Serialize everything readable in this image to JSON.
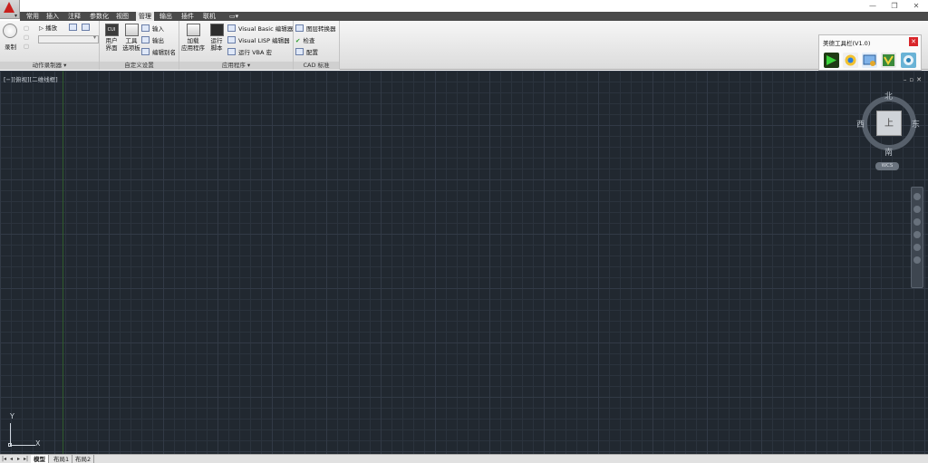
{
  "menu_tabs": [
    "常用",
    "插入",
    "注释",
    "参数化",
    "视图",
    "管理",
    "输出",
    "插件",
    "联机"
  ],
  "active_tab_index": 5,
  "ribbon": {
    "record_label": "录制",
    "play_label": "播放",
    "panel_action_recorder": "动作录制器",
    "cui_label_1": "用户",
    "cui_label_2": "界面",
    "tool_palette_1": "工具",
    "tool_palette_2": "选项板",
    "import_label": "输入",
    "export_label": "输出",
    "edit_alias_label": "编辑别名",
    "panel_custom": "自定义设置",
    "load_app_1": "加载",
    "load_app_2": "应用程序",
    "run_script_1": "运行",
    "run_script_2": "脚本",
    "vb_editor": "Visual Basic 编辑器",
    "lisp_editor": "Visual LISP 编辑器",
    "run_vba": "运行 VBA 宏",
    "panel_apps": "应用程序",
    "layer_translator": "图层转换器",
    "check_label": "检查",
    "configure_label": "配置",
    "panel_cad": "CAD 标准"
  },
  "toolbar_panel": {
    "title": "美德工具栏(V1.0)"
  },
  "viewport": {
    "label": "[−][俯视][二维线框]",
    "viewcube": {
      "north": "北",
      "south": "南",
      "east": "东",
      "west": "西",
      "face": "上",
      "wcs": "WCS"
    },
    "ucs": {
      "x": "X",
      "y": "Y"
    }
  },
  "layout_tabs": [
    "模型",
    "布局1",
    "布局2"
  ],
  "colors": {
    "viewport_bg": "#212830",
    "tabs_bg": "#4a4a4a",
    "accent_red": "#c8201d"
  }
}
